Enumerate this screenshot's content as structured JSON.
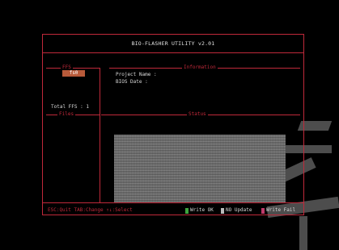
{
  "title": "BIO-FLASHER UTILITY v2.01",
  "sections": {
    "ffs": "FFS",
    "information": "Information",
    "files": "Files",
    "status": "Status"
  },
  "fs_tag": "fs0",
  "info": {
    "project_name": "Project Name :",
    "bios_date": "BIOS Date    :"
  },
  "total_ffs": "Total FFS : 1",
  "footer": {
    "keys": "ESC:Quit  TAB:Change  ↑↓:Select"
  },
  "legend": [
    {
      "label": "Write OK",
      "color": "#3fa43f"
    },
    {
      "label": "NO Update",
      "color": "#bbbbbb"
    },
    {
      "label": "Write Fail",
      "color": "#c03a6a"
    }
  ],
  "colors": {
    "frame": "#c0293a",
    "background": "#000000",
    "fs_tag_bg": "#b85a3a"
  }
}
